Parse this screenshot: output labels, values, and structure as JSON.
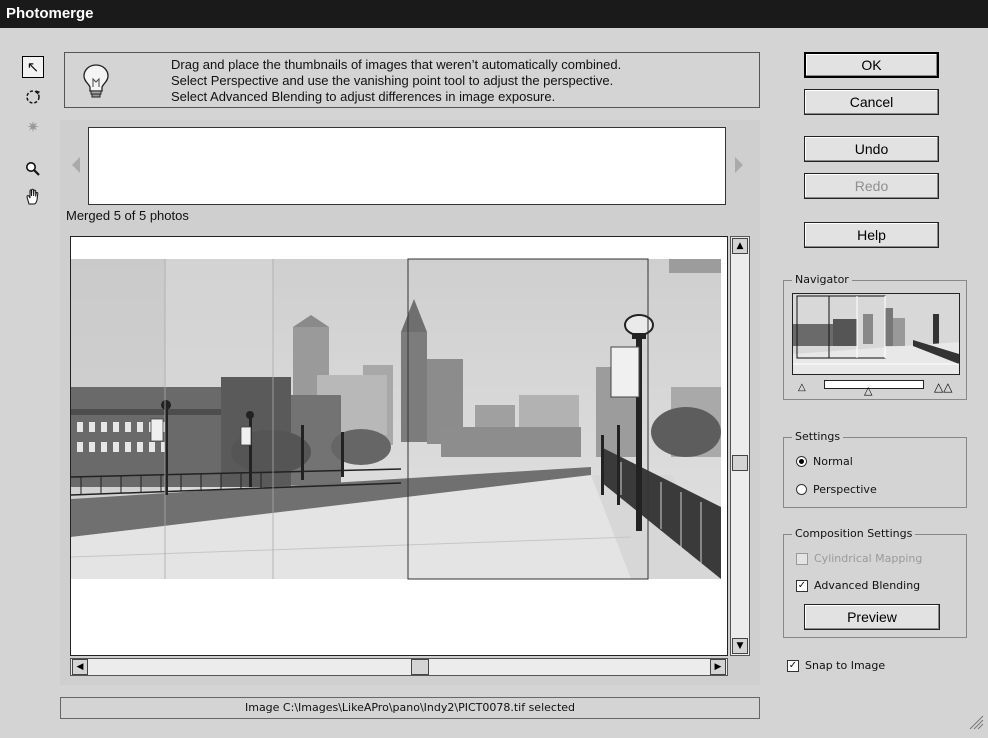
{
  "window": {
    "title": "Photomerge"
  },
  "tools": [
    {
      "name": "select-tool",
      "glyph": "↖"
    },
    {
      "name": "rotate-tool",
      "glyph": "↻"
    },
    {
      "name": "vanishing-point-tool",
      "glyph": "✷"
    },
    {
      "name": "zoom-tool",
      "glyph": "⌕"
    },
    {
      "name": "hand-tool",
      "glyph": "✋"
    }
  ],
  "tip": {
    "line1": "Drag and place the thumbnails of images that weren’t automatically combined.",
    "line2": "Select Perspective and use the vanishing point tool to adjust the perspective.",
    "line3": "Select Advanced Blending to adjust differences in image exposure."
  },
  "merged_label": "Merged 5 of 5 photos",
  "status_text": "Image C:\\Images\\LikeAPro\\pano\\Indy2\\PICT0078.tif selected",
  "buttons": {
    "ok": "OK",
    "cancel": "Cancel",
    "undo": "Undo",
    "redo": "Redo",
    "help": "Help",
    "preview": "Preview"
  },
  "navigator": {
    "label": "Navigator"
  },
  "settings": {
    "label": "Settings",
    "normal": "Normal",
    "perspective": "Perspective",
    "selected": "Normal"
  },
  "composition": {
    "label": "Composition Settings",
    "cylindrical": "Cylindrical Mapping",
    "cylindrical_checked": false,
    "advanced": "Advanced Blending",
    "advanced_checked": true
  },
  "snap": {
    "label": "Snap to Image",
    "checked": true
  },
  "colors": {
    "titlebar": "#1a1a1a",
    "dialog": "#d4d4d4",
    "canvas": "#ffffff"
  }
}
